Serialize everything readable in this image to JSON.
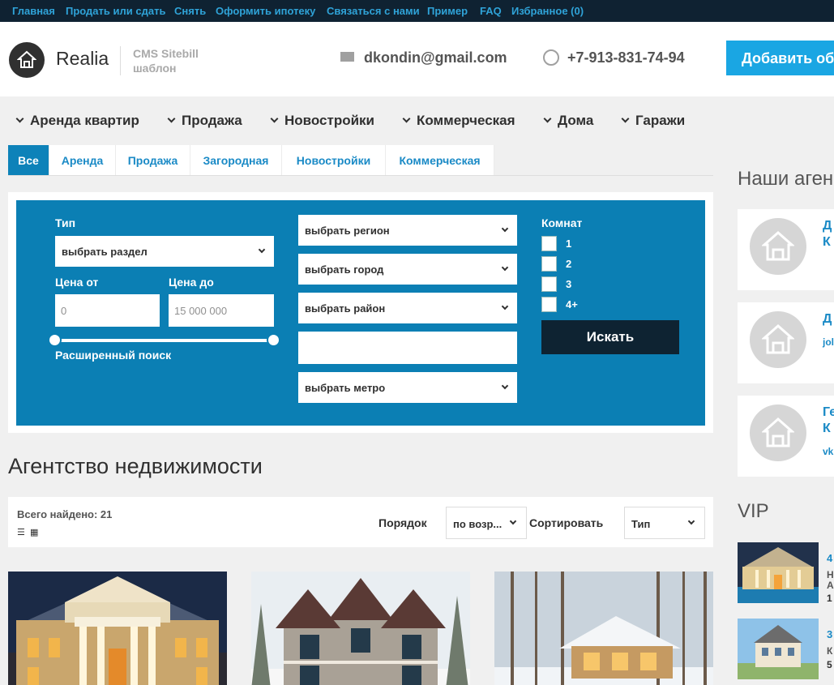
{
  "topnav": [
    "Главная",
    "Продать или сдать",
    "Снять",
    "Оформить ипотеку",
    "Связаться с нами",
    "Пример",
    "FAQ",
    "Избранное (0)"
  ],
  "header": {
    "logo": "Realia",
    "sub1": "CMS Sitebill",
    "sub2": "шаблон",
    "email": "dkondin@gmail.com",
    "phone": "+7-913-831-74-94",
    "add_button": "Добавить об"
  },
  "mainnav": [
    "Аренда квартир",
    "Продажа",
    "Новостройки",
    "Коммерческая",
    "Дома",
    "Гаражи"
  ],
  "tabs": [
    "Все",
    "Аренда",
    "Продажа",
    "Загородная",
    "Новостройки",
    "Коммерческая"
  ],
  "search": {
    "type_label": "Тип",
    "type_select": "выбрать раздел",
    "price_from_label": "Цена от",
    "price_to_label": "Цена до",
    "price_from_value": "0",
    "price_to_value": "15 000 000",
    "advanced": "Расширенный поиск",
    "region": "выбрать регион",
    "city": "выбрать город",
    "district": "выбрать район",
    "metro": "выбрать метро",
    "rooms_label": "Комнат",
    "rooms": [
      "1",
      "2",
      "3",
      "4+"
    ],
    "submit": "Искать"
  },
  "agency_title": "Агентство недвижимости",
  "results": {
    "found": "Всего найдено: 21",
    "order_label": "Порядок",
    "order_value": "по возр...",
    "sort_label": "Сортировать",
    "sort_value": "Тип"
  },
  "sidebar": {
    "agents_title": "Наши аген",
    "agents": [
      {
        "name": "Д",
        "name2": "К",
        "sub": ""
      },
      {
        "name": "Д",
        "name2": "",
        "sub": "jol"
      },
      {
        "name": "Ге",
        "name2": "К",
        "sub": "vk"
      }
    ],
    "vip_title": "VIP",
    "vip": [
      {
        "l1": "4",
        "l2": "Н",
        "l3": "А",
        "l4": "1"
      },
      {
        "l1": "3",
        "l2": "К",
        "l3": "",
        "l4": "5"
      }
    ]
  },
  "colors": {
    "topbar": "#0f2232",
    "accent": "#0b7fb4",
    "link": "#1a8ac6",
    "add_button": "#1aa6e3"
  }
}
